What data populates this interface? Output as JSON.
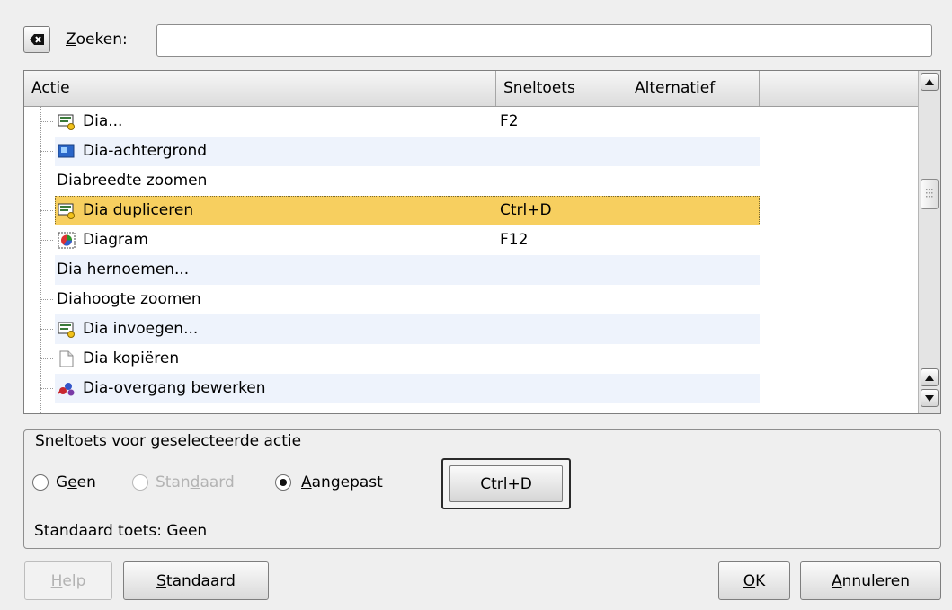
{
  "search": {
    "label_accel": "Z",
    "label_rest": "oeken:",
    "value": "",
    "placeholder": ""
  },
  "list": {
    "columns": [
      "Actie",
      "Sneltoets",
      "Alternatief",
      ""
    ],
    "rows": [
      {
        "label": "Dia...",
        "shortcut": "F2",
        "alt": "",
        "icon": "slide-icon"
      },
      {
        "label": "Dia-achtergrond",
        "shortcut": "",
        "alt": "",
        "icon": "background-icon"
      },
      {
        "label": "Diabreedte zoomen",
        "shortcut": "",
        "alt": "",
        "icon": ""
      },
      {
        "label": "Dia dupliceren",
        "shortcut": "Ctrl+D",
        "alt": "",
        "icon": "slide-icon",
        "selected": true
      },
      {
        "label": "Diagram",
        "shortcut": "F12",
        "alt": "",
        "icon": "diagram-icon"
      },
      {
        "label": "Dia hernoemen...",
        "shortcut": "",
        "alt": "",
        "icon": ""
      },
      {
        "label": "Diahoogte zoomen",
        "shortcut": "",
        "alt": "",
        "icon": ""
      },
      {
        "label": "Dia invoegen...",
        "shortcut": "",
        "alt": "",
        "icon": "slide-icon"
      },
      {
        "label": "Dia kopiëren",
        "shortcut": "",
        "alt": "",
        "icon": "document-icon"
      },
      {
        "label": "Dia-overgang bewerken",
        "shortcut": "",
        "alt": "",
        "icon": "transition-icon"
      }
    ]
  },
  "shortcut_group": {
    "title": "Sneltoets voor geselecteerde actie",
    "radio_none": {
      "pre": "G",
      "accel": "e",
      "post": "en"
    },
    "radio_default": {
      "pre": "Stan",
      "accel": "d",
      "post": "aard"
    },
    "radio_custom": {
      "pre": "",
      "accel": "A",
      "post": "angepast"
    },
    "selected": "custom",
    "key_button": "Ctrl+D",
    "default_key_text": "Standaard toets: Geen"
  },
  "buttons": {
    "help": {
      "accel": "H",
      "rest": "elp"
    },
    "default": {
      "accel": "S",
      "rest": "tandaard"
    },
    "ok": {
      "accel": "O",
      "rest": "K"
    },
    "cancel": {
      "accel": "A",
      "rest": "nnuleren"
    }
  },
  "colors": {
    "selection": "#f7cf5f",
    "alt_row": "#eef3fc"
  }
}
